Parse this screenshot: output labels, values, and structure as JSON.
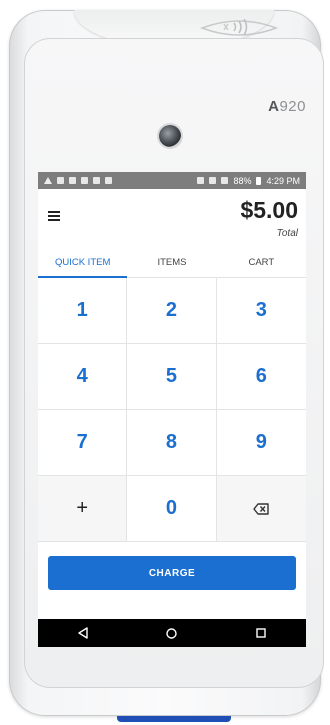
{
  "device": {
    "model_prefix": "A",
    "model_number": "920",
    "icons": [
      "nfc-icon",
      "camera-icon"
    ]
  },
  "statusbar": {
    "battery": "88%",
    "time": "4:29 PM"
  },
  "header": {
    "menu_icon": "menu-icon",
    "total_amount": "$5.00",
    "total_label": "Total"
  },
  "tabs": [
    {
      "label": "QUICK ITEM",
      "active": true
    },
    {
      "label": "ITEMS",
      "active": false
    },
    {
      "label": "CART",
      "active": false
    }
  ],
  "keypad": {
    "keys": [
      "1",
      "2",
      "3",
      "4",
      "5",
      "6",
      "7",
      "8",
      "9",
      "+",
      "0",
      ""
    ],
    "backspace_icon": "backspace-icon"
  },
  "charge": {
    "label": "CHARGE"
  },
  "navbar": {
    "icons": [
      "back-icon",
      "home-icon",
      "recents-icon"
    ]
  },
  "colors": {
    "accent": "#1a6fd0",
    "statusbar": "#7d7d7d",
    "navbar": "#000000",
    "strip": "#1f4fb4"
  }
}
